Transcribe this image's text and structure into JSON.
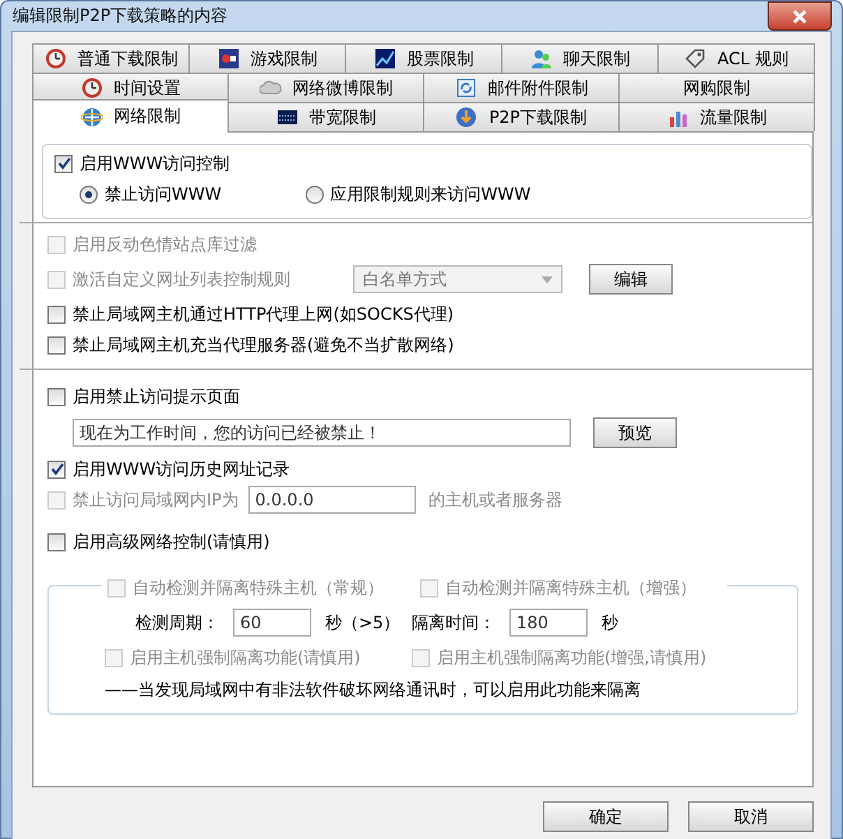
{
  "window": {
    "title": "编辑限制P2P下载策略的内容"
  },
  "tab_rows": [
    [
      {
        "label": "普通下载限制",
        "selected": false
      },
      {
        "label": "游戏限制",
        "selected": false
      },
      {
        "label": "股票限制",
        "selected": false
      },
      {
        "label": "聊天限制",
        "selected": false
      },
      {
        "label": "ACL 规则",
        "selected": false
      }
    ],
    [
      {
        "label": "时间设置",
        "selected": false
      },
      {
        "label": "网络微博限制",
        "selected": false
      },
      {
        "label": "邮件附件限制",
        "selected": false
      },
      {
        "label": "网购限制",
        "selected": false
      }
    ],
    [
      {
        "label": "网络限制",
        "selected": true
      },
      {
        "label": "带宽限制",
        "selected": false
      },
      {
        "label": "P2P下载限制",
        "selected": false
      },
      {
        "label": "流量限制",
        "selected": false
      }
    ]
  ],
  "www_access": {
    "label": "启用WWW访问控制",
    "checked": true,
    "radios": [
      {
        "label": "禁止访问WWW",
        "selected": true
      },
      {
        "label": "应用限制规则来访问WWW",
        "selected": false
      }
    ]
  },
  "options": [
    {
      "kind": "checkbox",
      "label": "启用反动色情站点库过滤",
      "checked": false,
      "disabled": true
    },
    {
      "kind": "url_list",
      "label": "激活自定义网址列表控制规则",
      "checked": false,
      "disabled": true,
      "dropdown": "白名单方式",
      "button": "编辑"
    },
    {
      "kind": "checkbox",
      "label": "禁止局域网主机通过HTTP代理上网(如SOCKS代理)",
      "checked": false,
      "disabled": false
    },
    {
      "kind": "checkbox",
      "label": "禁止局域网主机充当代理服务器(避免不当扩散网络)",
      "checked": false,
      "disabled": false
    }
  ],
  "block_page": {
    "label": "启用禁止访问提示页面",
    "checked": false,
    "message": "现在为工作时间，您的访问已经被禁止！",
    "button": "预览"
  },
  "history": {
    "label": "启用WWW访问历史网址记录",
    "checked": true
  },
  "lan_ip": {
    "label": "禁止访问局域网内IP为",
    "checked": false,
    "disabled": true,
    "value": "0.0.0.0",
    "suffix": "的主机或者服务器"
  },
  "advanced": {
    "label": "启用高级网络控制(请慎用)",
    "checked": false
  },
  "isolation": {
    "groups": [
      {
        "label": "自动检测并隔离特殊主机（常规）",
        "checked": false,
        "disabled": true,
        "field_label": "检测周期：",
        "value": "60",
        "unit": "秒（>5）",
        "force": {
          "label": "启用主机强制隔离功能(请慎用)",
          "checked": false,
          "disabled": true
        }
      },
      {
        "label": "自动检测并隔离特殊主机（增强）",
        "checked": false,
        "disabled": true,
        "field_label": "隔离时间：",
        "value": "180",
        "unit": "秒",
        "force": {
          "label": "启用主机强制隔离功能(增强,请慎用)",
          "checked": false,
          "disabled": true
        }
      }
    ],
    "note": "——当发现局域网中有非法软件破坏网络通讯时，可以启用此功能来隔离"
  },
  "buttons": [
    {
      "label": "确定"
    },
    {
      "label": "取消"
    }
  ]
}
